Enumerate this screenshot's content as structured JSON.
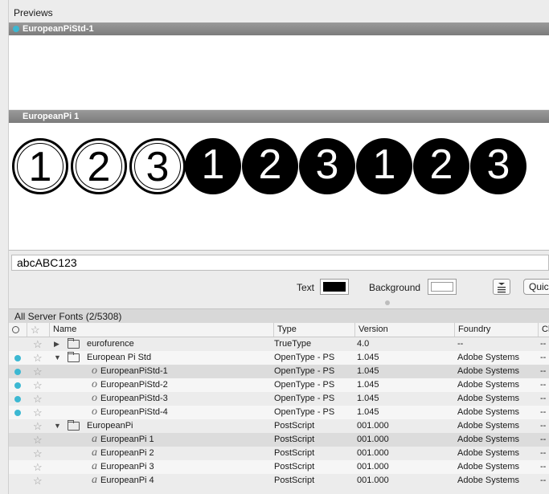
{
  "previews": {
    "header": "Previews",
    "panel1_title": "EuropeanPiStd-1",
    "panel2_title": "EuropeanPi 1",
    "glyphs": [
      "1",
      "2",
      "3",
      "1",
      "2",
      "3",
      "1",
      "2",
      "3"
    ]
  },
  "sample_text": "abcABC123",
  "controls": {
    "text_label": "Text",
    "background_label": "Background",
    "text_color": "#000000",
    "background_color": "#ffffff",
    "quick_label": "Quic"
  },
  "list": {
    "title": "All Server Fonts (2/5308)",
    "columns": [
      "Name",
      "Type",
      "Version",
      "Foundry",
      "Cl"
    ],
    "rows": [
      {
        "name": "eurofurence",
        "type": "TrueType",
        "version": "4.0",
        "foundry": "--",
        "c": "--",
        "dot": false,
        "indent": 0,
        "kind": "folder",
        "tri": "▶"
      },
      {
        "name": "European Pi Std",
        "type": "OpenType - PS",
        "version": "1.045",
        "foundry": "Adobe Systems",
        "c": "--",
        "dot": true,
        "indent": 0,
        "kind": "folder",
        "tri": "▼"
      },
      {
        "name": "EuropeanPiStd-1",
        "type": "OpenType - PS",
        "version": "1.045",
        "foundry": "Adobe Systems",
        "c": "--",
        "dot": true,
        "indent": 1,
        "kind": "otf",
        "sel": true
      },
      {
        "name": "EuropeanPiStd-2",
        "type": "OpenType - PS",
        "version": "1.045",
        "foundry": "Adobe Systems",
        "c": "--",
        "dot": true,
        "indent": 1,
        "kind": "otf"
      },
      {
        "name": "EuropeanPiStd-3",
        "type": "OpenType - PS",
        "version": "1.045",
        "foundry": "Adobe Systems",
        "c": "--",
        "dot": true,
        "indent": 1,
        "kind": "otf"
      },
      {
        "name": "EuropeanPiStd-4",
        "type": "OpenType - PS",
        "version": "1.045",
        "foundry": "Adobe Systems",
        "c": "--",
        "dot": true,
        "indent": 1,
        "kind": "otf"
      },
      {
        "name": "EuropeanPi",
        "type": "PostScript",
        "version": "001.000",
        "foundry": "Adobe Systems",
        "c": "--",
        "dot": false,
        "indent": 0,
        "kind": "folder",
        "tri": "▼"
      },
      {
        "name": "EuropeanPi 1",
        "type": "PostScript",
        "version": "001.000",
        "foundry": "Adobe Systems",
        "c": "--",
        "dot": false,
        "indent": 1,
        "kind": "ps",
        "sel": true
      },
      {
        "name": "EuropeanPi 2",
        "type": "PostScript",
        "version": "001.000",
        "foundry": "Adobe Systems",
        "c": "--",
        "dot": false,
        "indent": 1,
        "kind": "ps"
      },
      {
        "name": "EuropeanPi 3",
        "type": "PostScript",
        "version": "001.000",
        "foundry": "Adobe Systems",
        "c": "--",
        "dot": false,
        "indent": 1,
        "kind": "ps"
      },
      {
        "name": "EuropeanPi 4",
        "type": "PostScript",
        "version": "001.000",
        "foundry": "Adobe Systems",
        "c": "--",
        "dot": false,
        "indent": 1,
        "kind": "ps"
      }
    ]
  },
  "colors": {
    "activation_dot": "#3cb8d2"
  }
}
